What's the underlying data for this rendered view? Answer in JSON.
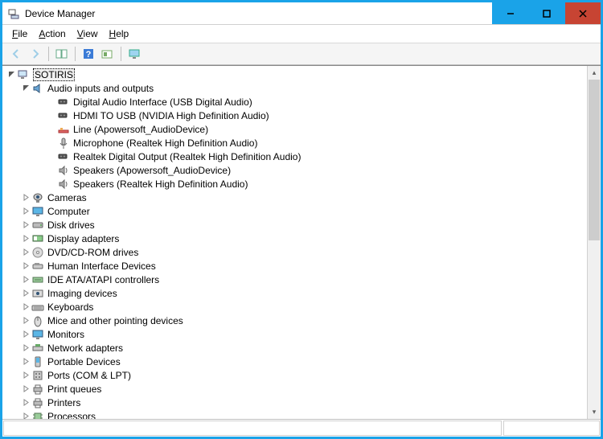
{
  "window": {
    "title": "Device Manager"
  },
  "menu": {
    "file": "File",
    "action": "Action",
    "view": "View",
    "help": "Help"
  },
  "tree": {
    "root": "SOTIRIS",
    "audio_category": "Audio inputs and outputs",
    "audio_children": [
      "Digital Audio Interface (USB Digital Audio)",
      "HDMI TO USB (NVIDIA High Definition Audio)",
      "Line (Apowersoft_AudioDevice)",
      "Microphone (Realtek High Definition Audio)",
      "Realtek Digital Output (Realtek High Definition Audio)",
      "Speakers (Apowersoft_AudioDevice)",
      "Speakers (Realtek High Definition Audio)"
    ],
    "categories": [
      "Cameras",
      "Computer",
      "Disk drives",
      "Display adapters",
      "DVD/CD-ROM drives",
      "Human Interface Devices",
      "IDE ATA/ATAPI controllers",
      "Imaging devices",
      "Keyboards",
      "Mice and other pointing devices",
      "Monitors",
      "Network adapters",
      "Portable Devices",
      "Ports (COM & LPT)",
      "Print queues",
      "Printers",
      "Processors"
    ]
  }
}
